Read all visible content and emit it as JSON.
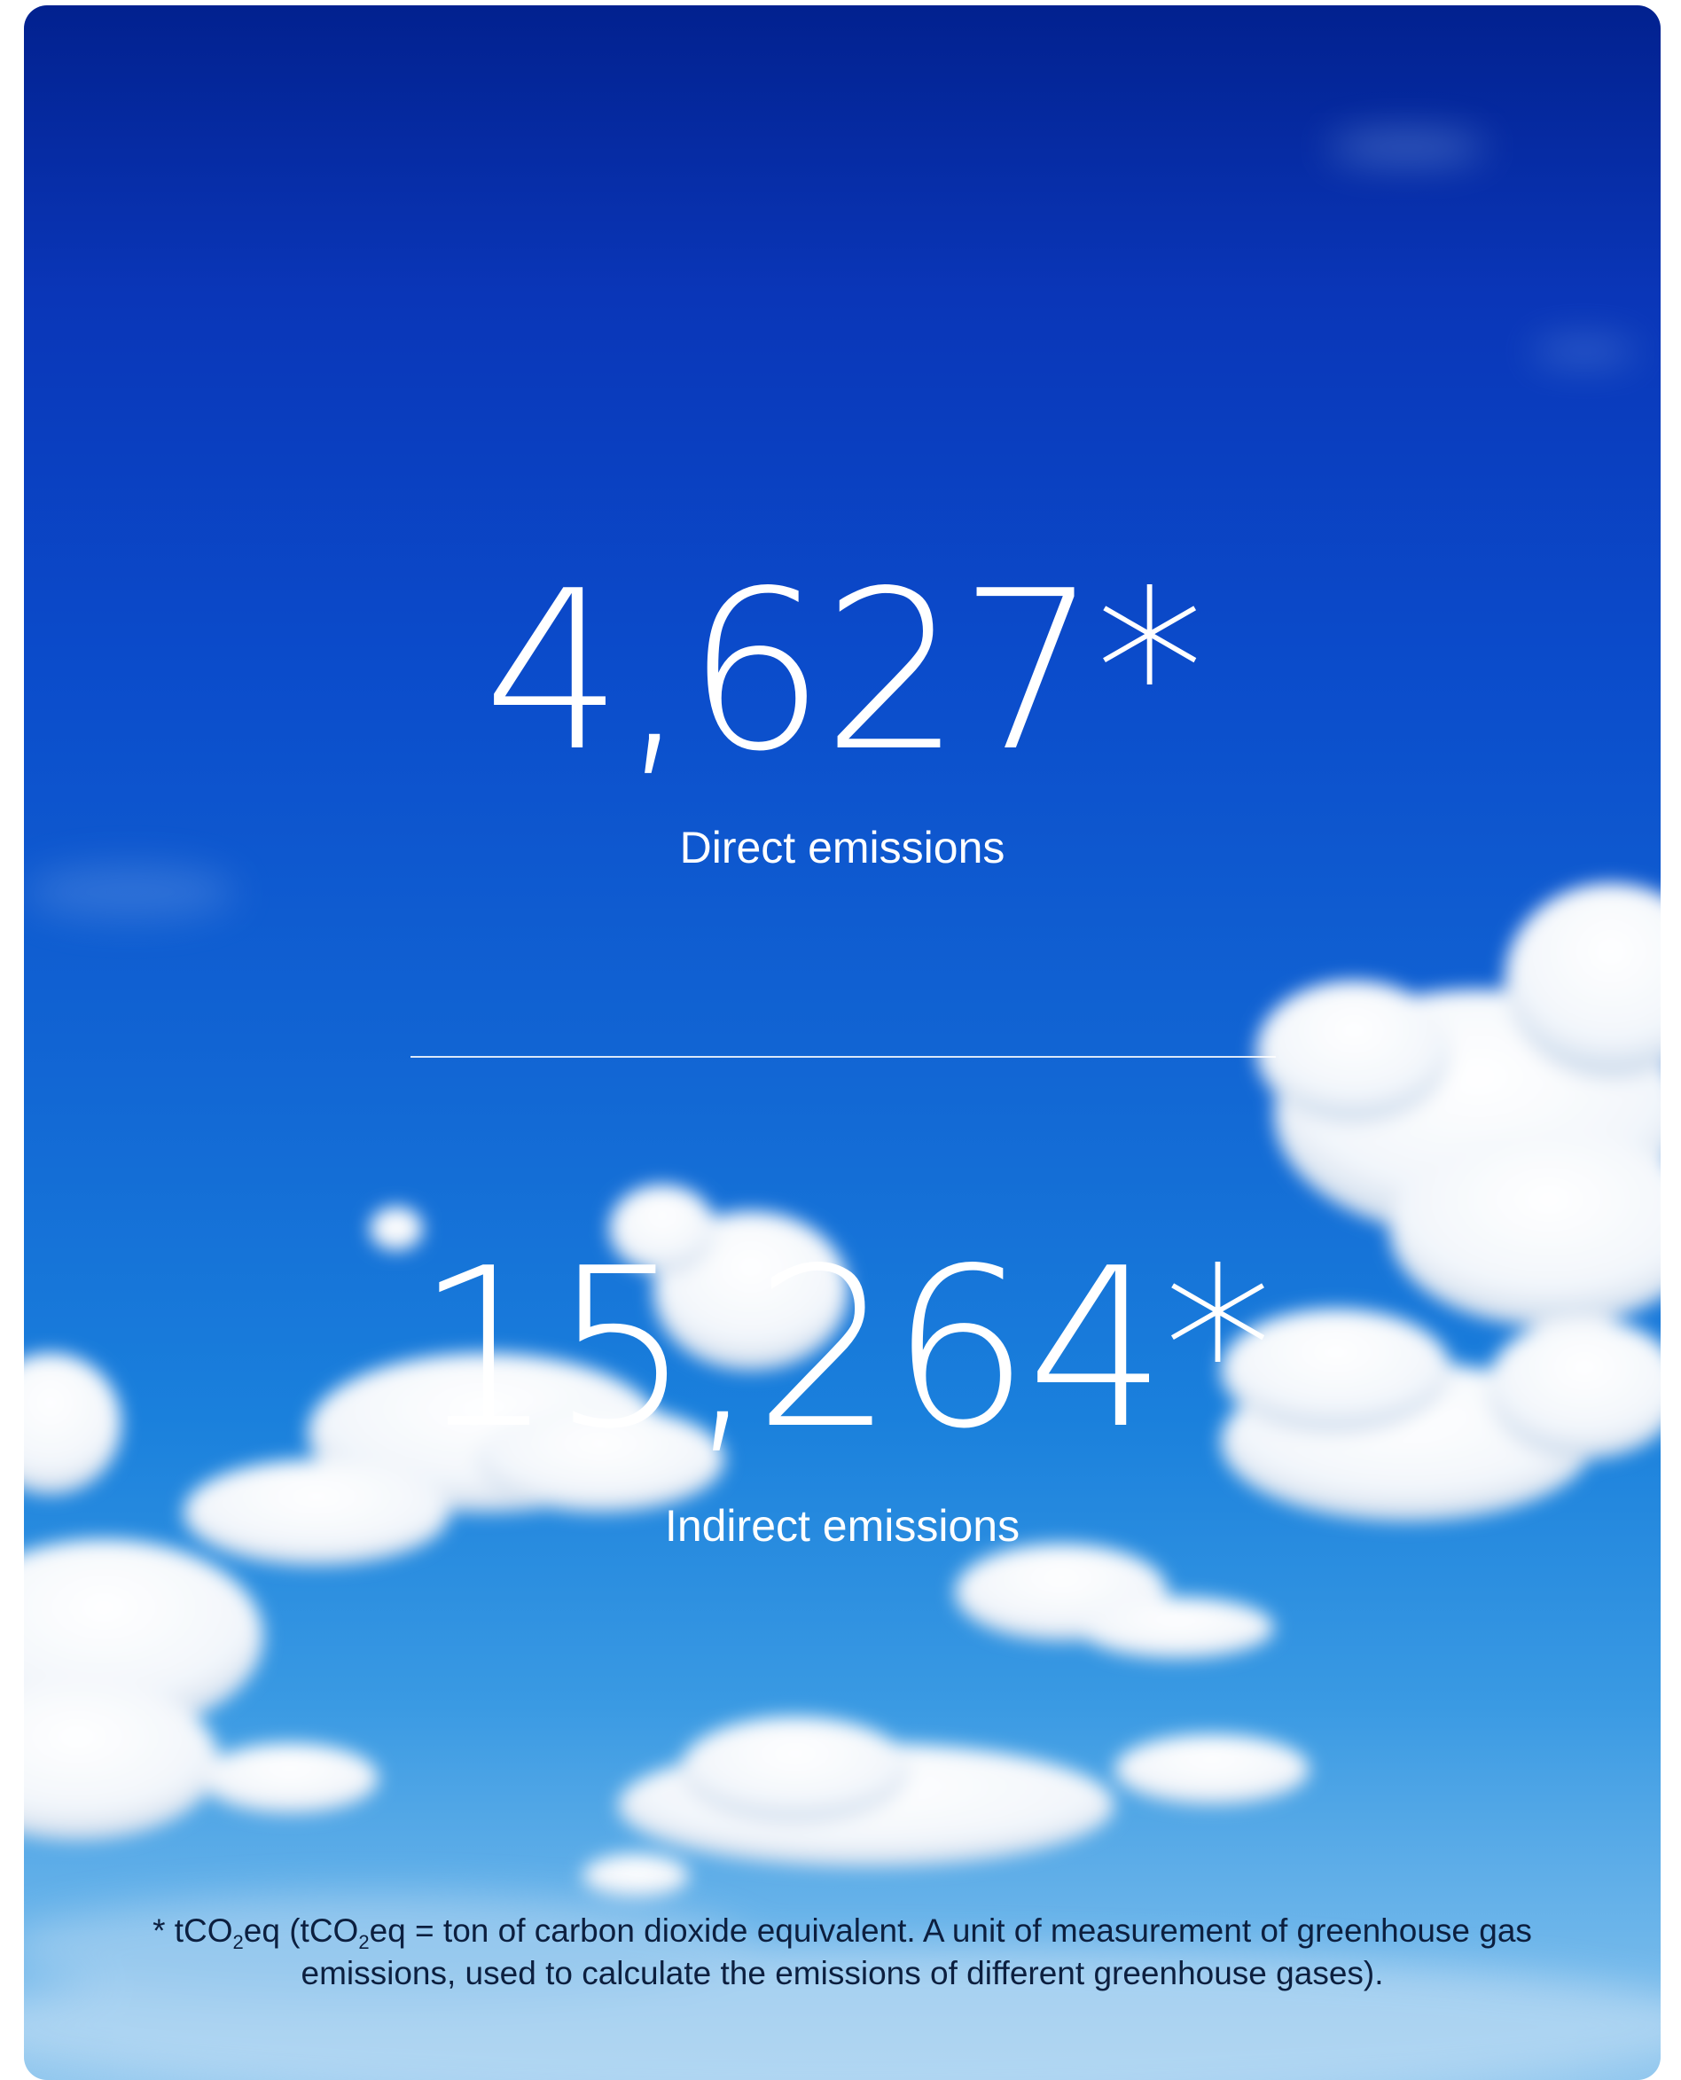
{
  "stats": {
    "direct": {
      "value": "4,627*",
      "label": "Direct emissions"
    },
    "indirect": {
      "value": "15,264*",
      "label": "Indirect emissions"
    }
  },
  "footnote": {
    "p1": "* tCO",
    "sub1": "2",
    "p2": "eq (tCO",
    "sub2": "2",
    "p3": "eq = ton of carbon dioxide equivalent. A unit of measurement of greenhouse gas emissions, used to calculate the emissions of different greenhouse gases)."
  },
  "colors": {
    "sky_top": "#02218f",
    "sky_bottom": "#8ec6ee",
    "text": "#ffffff",
    "footnote_text": "#0c1f3f"
  }
}
